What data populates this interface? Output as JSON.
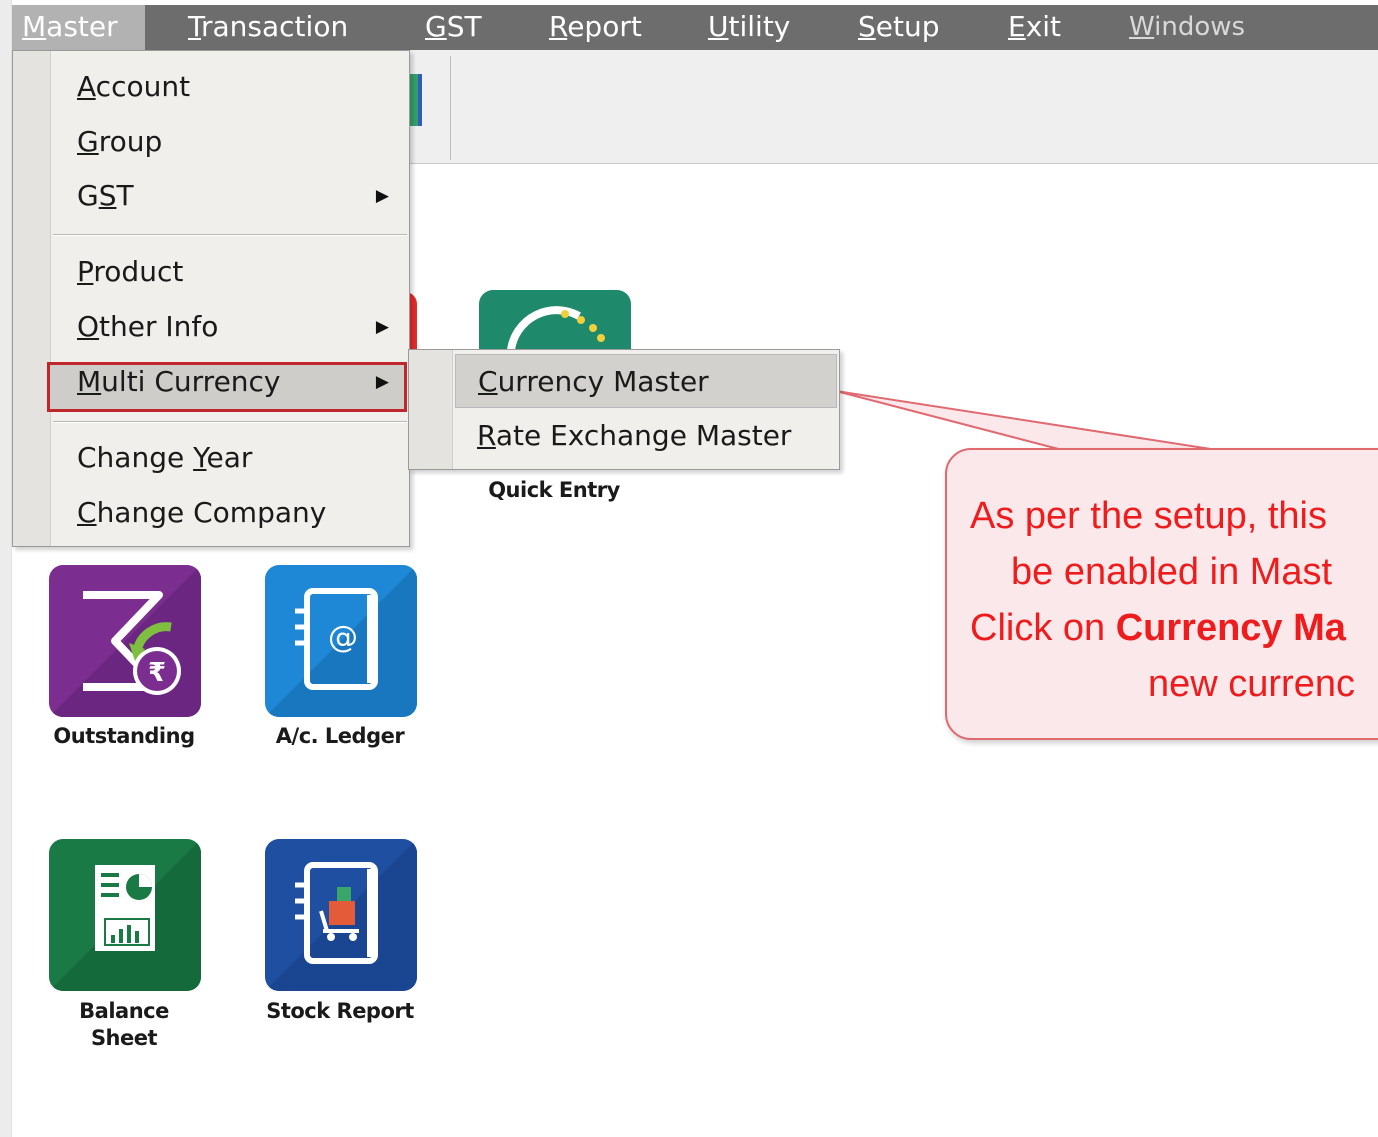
{
  "menubar": {
    "items": [
      {
        "label": "Master",
        "accel": "M",
        "rest": "aster"
      },
      {
        "label": "Transaction",
        "accel": "T",
        "rest": "ransaction"
      },
      {
        "label": "GST",
        "accel": "G",
        "rest": "ST"
      },
      {
        "label": "Report",
        "accel": "R",
        "rest": "eport"
      },
      {
        "label": "Utility",
        "accel": "U",
        "rest": "tility"
      },
      {
        "label": "Setup",
        "accel": "S",
        "rest": "etup"
      },
      {
        "label": "Exit",
        "accel": "E",
        "rest": "xit"
      },
      {
        "label": "Windows",
        "accel": "W",
        "rest": "indows"
      }
    ]
  },
  "master_menu": {
    "account": {
      "accel": "A",
      "rest": "ccount"
    },
    "group": {
      "accel": "G",
      "rest": "roup"
    },
    "gst": {
      "pre": "G",
      "accel": "S",
      "rest": "T"
    },
    "product": {
      "accel": "P",
      "rest": "roduct"
    },
    "other_info": {
      "accel": "O",
      "rest": "ther Info"
    },
    "multi_currency": {
      "accel": "M",
      "rest": "ulti Currency"
    },
    "change_year": {
      "pre": "Change ",
      "accel": "Y",
      "rest": "ear"
    },
    "change_company": {
      "accel": "C",
      "rest": "hange Company"
    }
  },
  "submenu": {
    "currency_master": {
      "accel": "C",
      "rest": "urrency Master"
    },
    "rate_exchange_master": {
      "accel": "R",
      "rest": "ate Exchange Master"
    }
  },
  "desktop": {
    "quick_entry": "Quick Entry",
    "outstanding": "Outstanding",
    "ac_ledger": "A/c. Ledger",
    "balance_sheet_1": "Balance",
    "balance_sheet_2": "Sheet",
    "stock_report": "Stock Report"
  },
  "callout": {
    "line1": "As per the setup, this",
    "line2": "be enabled in Mast",
    "line3_pre": "Click on ",
    "line3_bold": "Currency Ma",
    "line4": "new currenc"
  },
  "colors": {
    "menubar_bg": "#6d6d6d",
    "highlight_border": "#c0272d",
    "callout_text": "#ee1c1c",
    "callout_bg": "#fbe8ea"
  }
}
